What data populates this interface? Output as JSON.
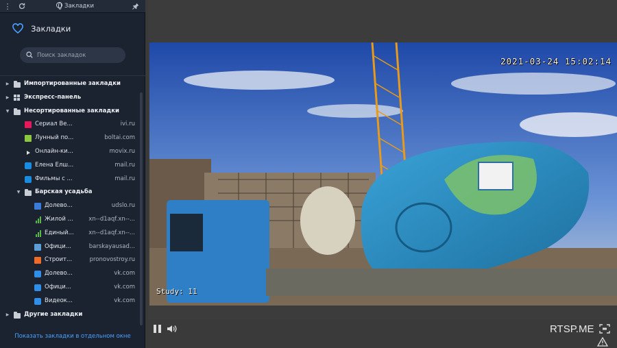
{
  "topbar": {
    "title": "Закладки",
    "icons": [
      "menu-dots-icon",
      "refresh-icon",
      "globe-icon",
      "pin-icon"
    ]
  },
  "panel": {
    "title": "Закладки",
    "icon": "heart-icon",
    "accent": "#4aa3ff"
  },
  "search": {
    "placeholder": "Поиск закладок"
  },
  "tree": [
    {
      "type": "folder",
      "level": 0,
      "expanded": false,
      "icon": "folder-icon",
      "label": "Импортированные закладки"
    },
    {
      "type": "folder",
      "level": 0,
      "expanded": false,
      "icon": "speed-dial-icon",
      "label": "Экспресс-панель"
    },
    {
      "type": "folder",
      "level": 0,
      "expanded": true,
      "icon": "folder-icon",
      "label": "Несортированные закладки"
    },
    {
      "type": "item",
      "level": 1,
      "icon": "ivi-icon",
      "color": "#e8185a",
      "label": "Сериал Ве...",
      "url": "ivi.ru"
    },
    {
      "type": "item",
      "level": 1,
      "icon": "boltai-icon",
      "color": "#8dc63f",
      "label": "Лунный по...",
      "url": "boltai.com"
    },
    {
      "type": "item",
      "level": 1,
      "icon": "movix-icon",
      "color": "#111111",
      "label": "Онлайн-ки...",
      "url": "movix.ru"
    },
    {
      "type": "item",
      "level": 1,
      "icon": "mail-icon",
      "color": "#168de2",
      "label": "Елена Елш...",
      "url": "mail.ru"
    },
    {
      "type": "item",
      "level": 1,
      "icon": "mail-icon",
      "color": "#168de2",
      "label": "Фильмы с ...",
      "url": "mail.ru"
    },
    {
      "type": "folder",
      "level": 1,
      "expanded": true,
      "icon": "folder-icon",
      "label": "Барская усадьба"
    },
    {
      "type": "item",
      "level": 2,
      "icon": "image-icon",
      "color": "#3a7bd5",
      "label": "Долево...",
      "url": "udslo.ru"
    },
    {
      "type": "item",
      "level": 2,
      "icon": "bars-icon",
      "color": "#5ab946",
      "label": "Жилой ...",
      "url": "xn--d1aqf.xn--..."
    },
    {
      "type": "item",
      "level": 2,
      "icon": "bars-icon",
      "color": "#5ab946",
      "label": "Единый...",
      "url": "xn--d1aqf.xn--..."
    },
    {
      "type": "item",
      "level": 2,
      "icon": "pattern-icon",
      "color": "#5c9fd6",
      "label": "Офици...",
      "url": "barskayausad..."
    },
    {
      "type": "item",
      "level": 2,
      "icon": "pronovostroy-icon",
      "color": "#f06a28",
      "label": "Строит...",
      "url": "pronovostroy.ru"
    },
    {
      "type": "item",
      "level": 2,
      "icon": "chat-icon",
      "color": "#2f8ee8",
      "label": "Долево...",
      "url": "vk.com"
    },
    {
      "type": "item",
      "level": 2,
      "icon": "chat-icon",
      "color": "#2f8ee8",
      "label": "Офици...",
      "url": "vk.com"
    },
    {
      "type": "item",
      "level": 2,
      "icon": "chat-icon",
      "color": "#2f8ee8",
      "label": "Видеок...",
      "url": "vk.com"
    },
    {
      "type": "folder",
      "level": 0,
      "expanded": false,
      "icon": "folder-icon",
      "label": "Другие закладки"
    }
  ],
  "footer": {
    "link": "Показать закладки в отдельном окне"
  },
  "player": {
    "timestamp": "2021-03-24 15:02:14",
    "watermark": "Study: 11",
    "brand": "RTSP.ME"
  }
}
